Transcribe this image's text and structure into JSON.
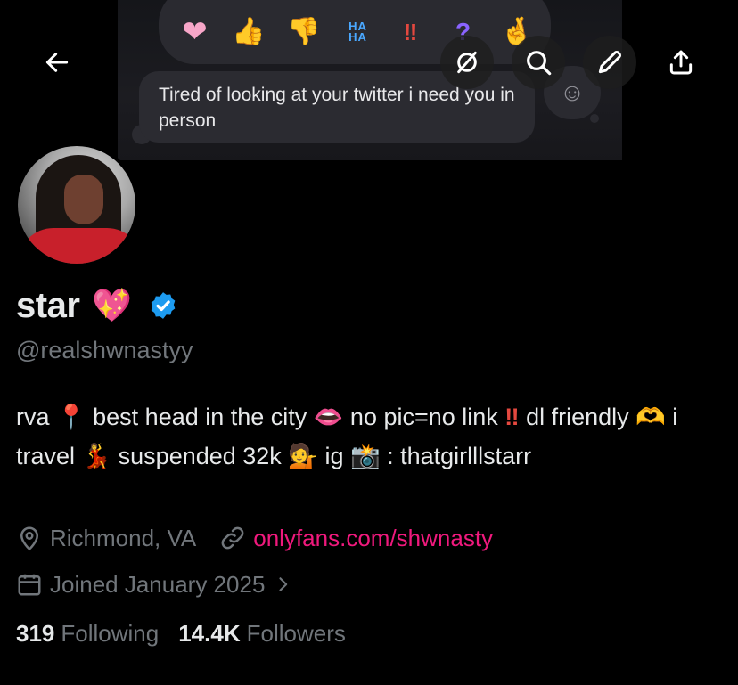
{
  "banner": {
    "reactions": [
      "❤",
      "👍",
      "👎",
      "HA HA",
      "‼",
      "?",
      "🤞"
    ],
    "message": "Tired of looking at your twitter i need you in person",
    "side_emoji": "☺"
  },
  "toolbar": {
    "back_icon": "arrow-left-icon",
    "grok_icon": "grok-slash-icon",
    "search_icon": "search-icon",
    "edit_icon": "pencil-icon",
    "share_icon": "share-icon"
  },
  "profile": {
    "display_name": "star",
    "name_emoji": "💖",
    "verified": true,
    "handle": "@realshwnastyy",
    "bio": {
      "t1": "rva ",
      "e1": "📍",
      "t2": " best head in the city ",
      "e2": "👄",
      "t3": " no pic=no link ",
      "e3": "‼",
      "t4": " dl friendly ",
      "e4": "🫶",
      "t5": " i travel ",
      "e5": "💃",
      "t6": " suspended 32k ",
      "e6": "💁",
      "t7": " ig ",
      "e7": "📸",
      "t8": " : thatgirlllstarr"
    },
    "location": "Richmond, VA",
    "website": "onlyfans.com/shwnasty",
    "joined": "Joined January 2025",
    "following_count": "319",
    "following_label": "Following",
    "followers_count": "14.4K",
    "followers_label": "Followers"
  },
  "colors": {
    "background": "#000000",
    "primary_text": "#e7e9ea",
    "secondary_text": "#71767b",
    "link": "#f0197d",
    "verified": "#1d9bf0"
  }
}
